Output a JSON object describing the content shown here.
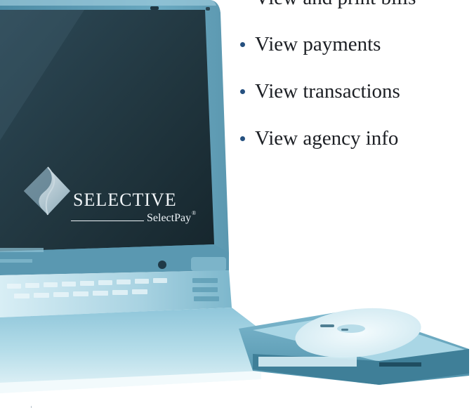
{
  "features": {
    "items": [
      {
        "label": "View and print bills"
      },
      {
        "label": "View payments"
      },
      {
        "label": "View transactions"
      },
      {
        "label": "View agency info"
      }
    ],
    "bullet_color": "#25507f"
  },
  "logo": {
    "wordmark": "SELECTIVE",
    "product": "SelectPay",
    "registered": "®"
  },
  "colors": {
    "screen": "#20343f",
    "laptop_body": "#7fb9cf",
    "highlight": "#d9eef5"
  }
}
